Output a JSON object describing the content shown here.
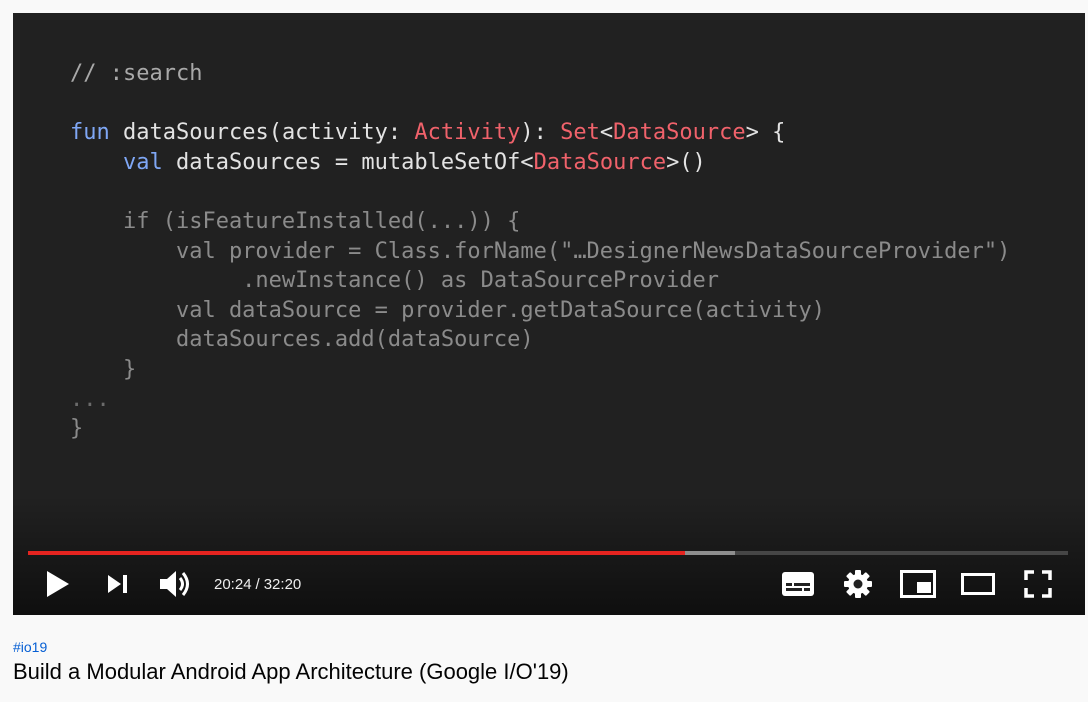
{
  "video": {
    "code_lines": [
      [
        {
          "t": "// :search",
          "c": "c-cmt"
        }
      ],
      [],
      [
        {
          "t": "fun",
          "c": "c-kw"
        },
        {
          "t": " dataSources("
        },
        {
          "t": "activity"
        },
        {
          "t": ": "
        },
        {
          "t": "Activity",
          "c": "c-type"
        },
        {
          "t": "): "
        },
        {
          "t": "Set",
          "c": "c-type"
        },
        {
          "t": "<"
        },
        {
          "t": "DataSource",
          "c": "c-type"
        },
        {
          "t": "> {"
        }
      ],
      [
        {
          "t": "    "
        },
        {
          "t": "val",
          "c": "c-kw"
        },
        {
          "t": " dataSources = mutableSetOf<"
        },
        {
          "t": "DataSource",
          "c": "c-type"
        },
        {
          "t": ">()"
        }
      ],
      [],
      [
        {
          "t": "    if (isFeatureInstalled(...)) {",
          "c": "c-dim"
        }
      ],
      [
        {
          "t": "        val provider = Class.forName(\"…DesignerNewsDataSourceProvider\")",
          "c": "c-dim"
        }
      ],
      [
        {
          "t": "             .newInstance() as DataSourceProvider",
          "c": "c-dim"
        }
      ],
      [
        {
          "t": "        val dataSource = provider.getDataSource(activity)",
          "c": "c-dim"
        }
      ],
      [
        {
          "t": "        dataSources.add(dataSource)",
          "c": "c-dim"
        }
      ],
      [
        {
          "t": "    }",
          "c": "c-dim"
        }
      ],
      [
        {
          "t": "...",
          "c": "c-dimkw"
        }
      ],
      [
        {
          "t": "}",
          "c": "c-dim"
        }
      ]
    ]
  },
  "player": {
    "current_time": "20:24",
    "separator": "/",
    "duration": "32:20",
    "progress_played_fraction": 0.632,
    "progress_buffered_fraction": 0.68,
    "colors": {
      "played": "#e52420",
      "background": "#212121"
    },
    "controls_left": [
      "play-icon",
      "skip-next-icon",
      "volume-icon"
    ],
    "controls_right": [
      "subtitles-icon",
      "settings-icon",
      "miniplayer-icon",
      "theater-mode-icon",
      "fullscreen-icon"
    ]
  },
  "info": {
    "hashtag": "#io19",
    "title": "Build a Modular Android App Architecture (Google I/O'19)"
  }
}
